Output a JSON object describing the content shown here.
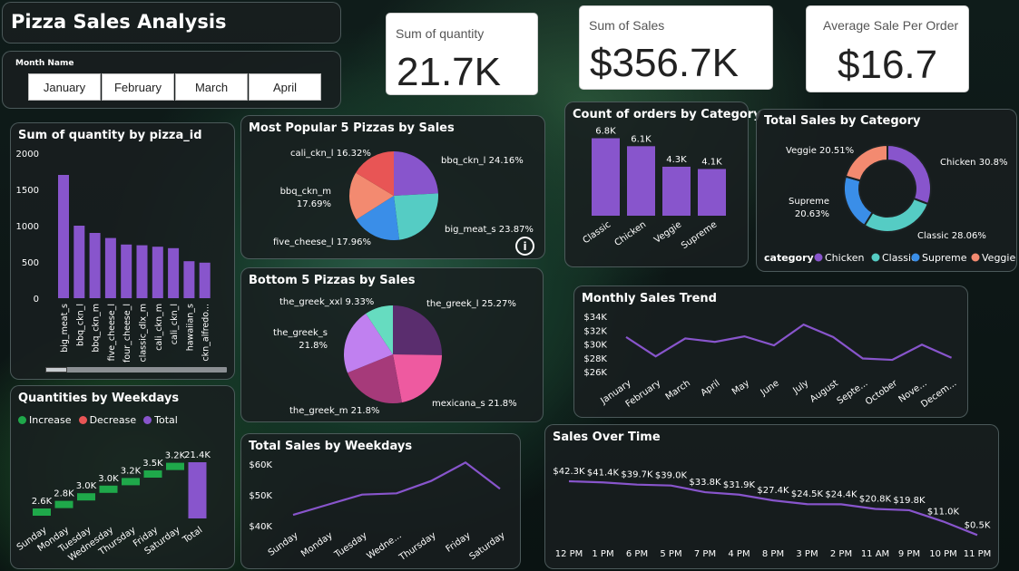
{
  "header": {
    "title": "Pizza Sales Analysis"
  },
  "slicer": {
    "title": "Month Name",
    "options": [
      "January",
      "February",
      "March",
      "April"
    ]
  },
  "kpis": [
    {
      "title": "Sum of quantity",
      "value": "21.7K"
    },
    {
      "title": "Sum of Sales",
      "value": "$356.7K"
    },
    {
      "title": "Average Sale Per Order",
      "value": "$16.7"
    }
  ],
  "colors": {
    "purple": "#8855cc",
    "teal": "#55ccc4",
    "blue": "#3a8ee8",
    "salmon": "#f38a70",
    "green": "#1fa84a",
    "red": "#e85555"
  },
  "chart_data": [
    {
      "id": "qty_by_pizza",
      "type": "bar",
      "title": "Sum of quantity by pizza_id",
      "categories": [
        "big_meat_s",
        "bbq_ckn_l",
        "bbq_ckn_m",
        "five_cheese_l",
        "four_cheese_l",
        "classic_dlx_m",
        "cali_ckn_m",
        "cali_ckn_l",
        "hawaiian_s",
        "ckn_alfredo_m"
      ],
      "category_labels": [
        "big_meat_s",
        "bbq_ckn_l",
        "bbq_ckn_m",
        "five_cheese_l",
        "four_cheese_l",
        "classic_dlx_m",
        "cali_ckn_m",
        "cali_ckn_l",
        "hawaiian_s",
        "ckn_alfredo..."
      ],
      "values": [
        1700,
        1000,
        900,
        830,
        740,
        730,
        710,
        690,
        510,
        490
      ],
      "yticks": [
        "0",
        "500",
        "1000",
        "1500",
        "2000"
      ],
      "ylim": [
        0,
        2000
      ]
    },
    {
      "id": "top5",
      "type": "pie",
      "title": "Most Popular 5 Pizzas by Sales",
      "slices": [
        {
          "label": "bbq_ckn_l 24.16%",
          "value": 24.16,
          "color": "#8855cc"
        },
        {
          "label": "big_meat_s 23.87%",
          "value": 23.87,
          "color": "#55ccc4"
        },
        {
          "label": "five_cheese_l 17.96%",
          "value": 17.96,
          "color": "#3a8ee8"
        },
        {
          "label": "bbq_ckn_m",
          "label2": "17.69%",
          "value": 17.69,
          "color": "#f38a70"
        },
        {
          "label": "cali_ckn_l 16.32%",
          "value": 16.32,
          "color": "#e85555"
        }
      ]
    },
    {
      "id": "bottom5",
      "type": "pie",
      "title": "Bottom 5 Pizzas by Sales",
      "slices": [
        {
          "label": "the_greek_l 25.27%",
          "value": 25.27,
          "color": "#5a2d6e"
        },
        {
          "label": "mexicana_s 21.8%",
          "value": 21.8,
          "color": "#ee5aa0"
        },
        {
          "label": "the_greek_m 21.8%",
          "value": 21.8,
          "color": "#a63a7a"
        },
        {
          "label": "the_greek_s",
          "label2": "21.8%",
          "value": 21.8,
          "color": "#c080f0"
        },
        {
          "label": "the_greek_xxl 9.33%",
          "value": 9.33,
          "color": "#66dcc0"
        }
      ]
    },
    {
      "id": "orders_by_category",
      "type": "bar",
      "title": "Count of orders by Category",
      "categories": [
        "Classic",
        "Chicken",
        "Veggie",
        "Supreme"
      ],
      "values": [
        6800,
        6100,
        4300,
        4100
      ],
      "data_labels": [
        "6.8K",
        "6.1K",
        "4.3K",
        "4.1K"
      ]
    },
    {
      "id": "sales_by_category",
      "type": "pie",
      "title": "Total Sales by Category",
      "legend_title": "category",
      "slices": [
        {
          "name": "Chicken",
          "label": "Chicken 30.8%",
          "value": 30.8,
          "color": "#8855cc"
        },
        {
          "name": "Classic",
          "label": "Classic 28.06%",
          "value": 28.06,
          "color": "#55ccc4"
        },
        {
          "name": "Supreme",
          "label": "Supreme",
          "label2": "20.63%",
          "value": 20.63,
          "color": "#3a8ee8"
        },
        {
          "name": "Veggie",
          "label": "Veggie 20.51%",
          "value": 20.51,
          "color": "#f38a70"
        }
      ]
    },
    {
      "id": "monthly_trend",
      "type": "line",
      "title": "Monthly Sales Trend",
      "categories": [
        "January",
        "February",
        "March",
        "April",
        "May",
        "June",
        "July",
        "August",
        "Septe...",
        "October",
        "Nove...",
        "Decem..."
      ],
      "values": [
        31000,
        28200,
        30800,
        30300,
        31100,
        29800,
        32800,
        31000,
        27900,
        27700,
        29900,
        28000
      ],
      "yticks": [
        "$26K",
        "$28K",
        "$30K",
        "$32K",
        "$34K"
      ],
      "ylim": [
        26000,
        34000
      ]
    },
    {
      "id": "qty_by_weekday",
      "type": "waterfall",
      "title": "Quantities by Weekdays",
      "legend": [
        "Increase",
        "Decrease",
        "Total"
      ],
      "categories": [
        "Sunday",
        "Monday",
        "Tuesday",
        "Wednesday",
        "Thursday",
        "Friday",
        "Saturday",
        "Total"
      ],
      "values": [
        2.6,
        2.8,
        3.0,
        3.0,
        3.2,
        3.5,
        3.2,
        21.4
      ],
      "data_labels": [
        "2.6K",
        "2.8K",
        "3.0K",
        "3.0K",
        "3.2K",
        "3.5K",
        "3.2K",
        "21.4K"
      ]
    },
    {
      "id": "sales_by_weekday",
      "type": "line",
      "title": "Total Sales by Weekdays",
      "categories": [
        "Sunday",
        "Monday",
        "Tuesday",
        "Wedne...",
        "Thursday",
        "Friday",
        "Saturday"
      ],
      "values": [
        43500,
        46800,
        50100,
        50500,
        54500,
        60500,
        52000
      ],
      "yticks": [
        "$40K",
        "$50K",
        "$60K"
      ],
      "ylim": [
        40000,
        60000
      ]
    },
    {
      "id": "sales_over_time",
      "type": "line",
      "title": "Sales Over Time",
      "categories": [
        "12 PM",
        "1 PM",
        "6 PM",
        "5 PM",
        "7 PM",
        "4 PM",
        "8 PM",
        "3 PM",
        "2 PM",
        "11 AM",
        "9 PM",
        "10 PM",
        "11 PM"
      ],
      "values": [
        42.3,
        41.4,
        39.7,
        39.0,
        33.8,
        31.9,
        27.4,
        24.5,
        24.4,
        20.8,
        19.8,
        11.0,
        0.5
      ],
      "data_labels": [
        "$42.3K",
        "$41.4K",
        "$39.7K",
        "$39.0K",
        "$33.8K",
        "$31.9K",
        "$27.4K",
        "$24.5K",
        "$24.4K",
        "$20.8K",
        "$19.8K",
        "$11.0K",
        "$0.5K"
      ]
    }
  ]
}
